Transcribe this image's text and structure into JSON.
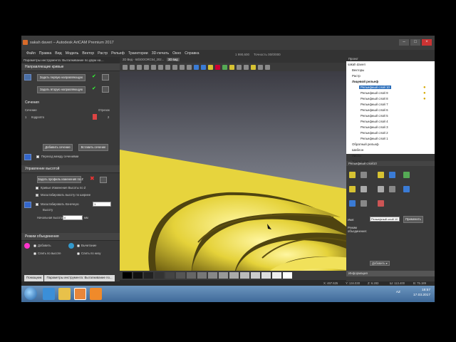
{
  "window": {
    "title": "sakah daveri – Autodesk ArtCAM Premium 2017"
  },
  "menu": [
    "Файл",
    "Правка",
    "Вид",
    "Модель",
    "Вектор",
    "Растр",
    "Рельеф",
    "Траектории",
    "3D-печать",
    "Окно",
    "Справка"
  ],
  "top_tools": {
    "value": "1 990,600",
    "snap": "Точность 00/0/000"
  },
  "left_panel": {
    "title": "Параметры инструмента: Выталкивание по двум на…",
    "guide_section": "Направляющие кривые",
    "btn_first_guide": "Задать первую направляющую",
    "btn_second_guide": "Задать вторую направляющую",
    "sections_header": "Сечения",
    "col_section": "Сечение",
    "col_offset": "Отрезок",
    "row_index": "1",
    "row_name": "Кодропто",
    "row_value": "2",
    "btn_add_section": "Добавить сечение",
    "btn_insert_section": "Вставить сечение",
    "cb_transition": "Переход между сечениями",
    "height_header": "Управление высотой",
    "btn_height_profile": "Задать профиль изменения по Z",
    "cb_height_curve": "Кривые Изменения Высоты по Z",
    "cb_scale_width": "Масштабировать высоту по ширине",
    "cb_scale_end": "Масштабировать Конечную",
    "label_height": "Высоту",
    "label_start_height": "Начальная высота",
    "start_height_value": "0",
    "unit": "мм",
    "scale_value": "1",
    "mode_header": "Режим объединения",
    "mode_add": "Добавить",
    "mode_subtract": "Вычитание",
    "mode_merge_high": "Слить по высоте",
    "mode_merge_low": "Слить по низу"
  },
  "view_tabs": [
    "2D Вид - 64bOOORC54_202...",
    "3D вид"
  ],
  "right_panel": {
    "project_label": "Проект",
    "tree": [
      {
        "label": "sakah daveri",
        "indent": 0
      },
      {
        "label": "Векторы",
        "indent": 1
      },
      {
        "label": "Растр",
        "indent": 1
      },
      {
        "label": "Лицевой рельеф",
        "indent": 1
      },
      {
        "label": "Рельефный слой 10",
        "indent": 2,
        "selected": true
      },
      {
        "label": "Рельефный слой 9",
        "indent": 2
      },
      {
        "label": "Рельефный слой 8",
        "indent": 2
      },
      {
        "label": "Рельефный слой 7",
        "indent": 2
      },
      {
        "label": "Рельефный слой 6",
        "indent": 2
      },
      {
        "label": "Рельефный слой 5",
        "indent": 2
      },
      {
        "label": "Рельефный слой 4",
        "indent": 2
      },
      {
        "label": "Рельефный слой 3",
        "indent": 2
      },
      {
        "label": "Рельефный слой 2",
        "indent": 2
      },
      {
        "label": "Рельефный слой 1",
        "indent": 2
      },
      {
        "label": "Обратный рельеф",
        "indent": 1
      },
      {
        "label": "Шаблон",
        "indent": 1
      },
      {
        "label": "Листы",
        "indent": 1
      },
      {
        "label": "Траектории",
        "indent": 1
      }
    ],
    "layer_panel_title": "Рельефный слой10",
    "layer_name_value": "Рельефный слой 10",
    "apply_button": "Применить",
    "field_name_label": "Имя:",
    "mode_label": "Режим объединения:",
    "mode_value": "Добавить",
    "info_label": "Информация",
    "side_tab": "Инструменты"
  },
  "status": {
    "x": "X: 467.625",
    "y": "Y: 134.030",
    "z": "Z: 6.283",
    "w": "Ш: 113.400",
    "h": "В: 75.189"
  },
  "bottom_tabs": [
    "Помощник",
    "Параметры инструмента: Выталкивание по..."
  ],
  "taskbar": {
    "lang": "AZ",
    "time": "18:57",
    "date": "17.03.2017"
  }
}
